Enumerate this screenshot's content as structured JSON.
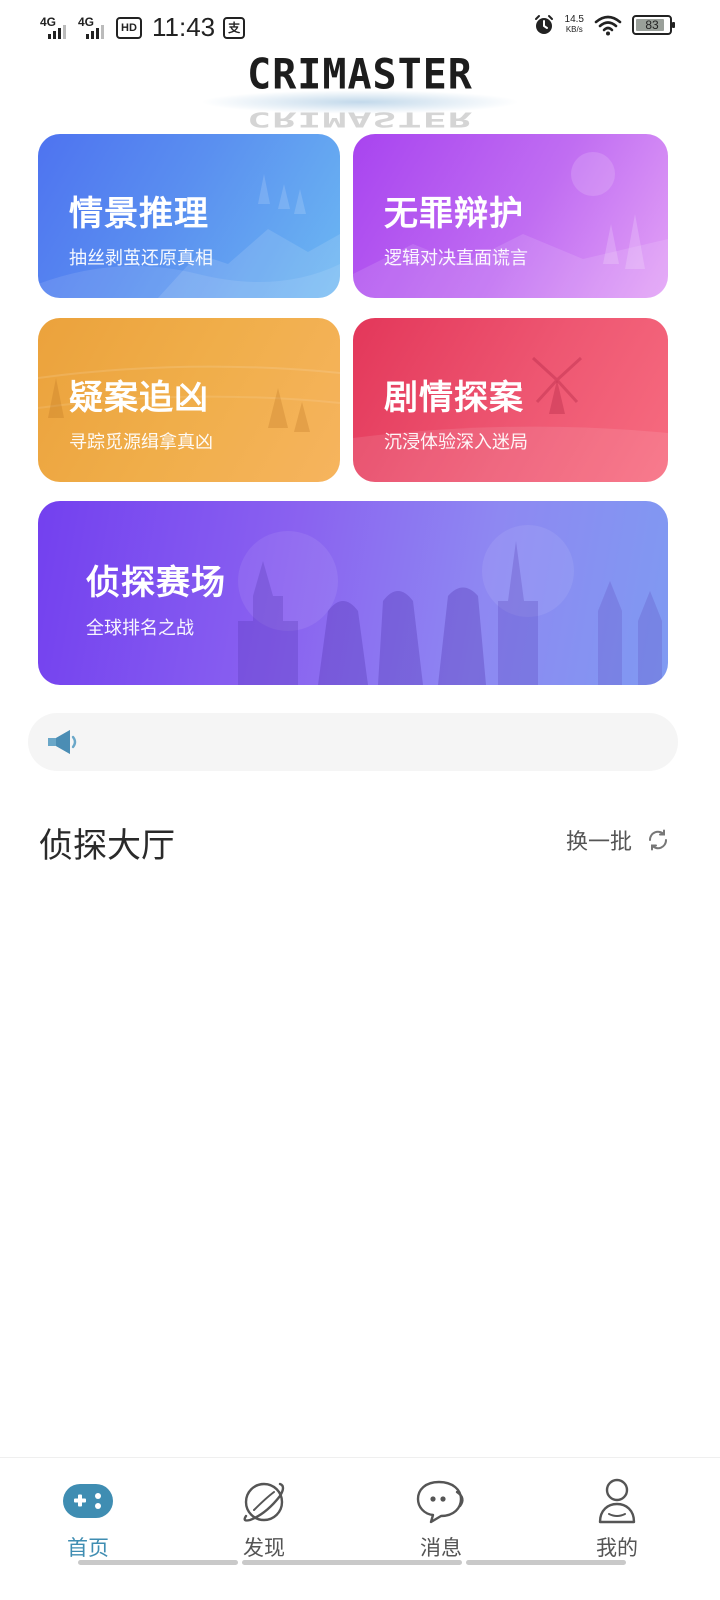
{
  "status_bar": {
    "network_1": "4G",
    "network_2": "4G",
    "hd": "HD",
    "time": "11:43",
    "app_badge": "支",
    "speed_value": "14.5",
    "speed_unit": "KB/s",
    "battery": "83"
  },
  "logo": {
    "text": "CRIMASTER"
  },
  "cards": [
    {
      "title": "情景推理",
      "subtitle": "抽丝剥茧还原真相"
    },
    {
      "title": "无罪辩护",
      "subtitle": "逻辑对决直面谎言"
    },
    {
      "title": "疑案追凶",
      "subtitle": "寻踪觅源缉拿真凶"
    },
    {
      "title": "剧情探案",
      "subtitle": "沉浸体验深入迷局"
    },
    {
      "title": "侦探赛场",
      "subtitle": "全球排名之战"
    }
  ],
  "notice": {
    "icon": "megaphone-icon",
    "text": ""
  },
  "hall": {
    "title": "侦探大厅",
    "refresh_label": "换一批"
  },
  "nav": {
    "items": [
      {
        "label": "首页",
        "icon": "gamepad-icon",
        "active": true
      },
      {
        "label": "发现",
        "icon": "planet-icon",
        "active": false
      },
      {
        "label": "消息",
        "icon": "chat-icon",
        "active": false
      },
      {
        "label": "我的",
        "icon": "person-icon",
        "active": false
      }
    ]
  },
  "colors": {
    "active_tab": "#3f8db2",
    "card_1": "#5a8ff0",
    "card_2": "#c06df2",
    "card_3": "#f0ae4a",
    "card_4": "#ee5772",
    "card_5": "#8a62f0"
  }
}
